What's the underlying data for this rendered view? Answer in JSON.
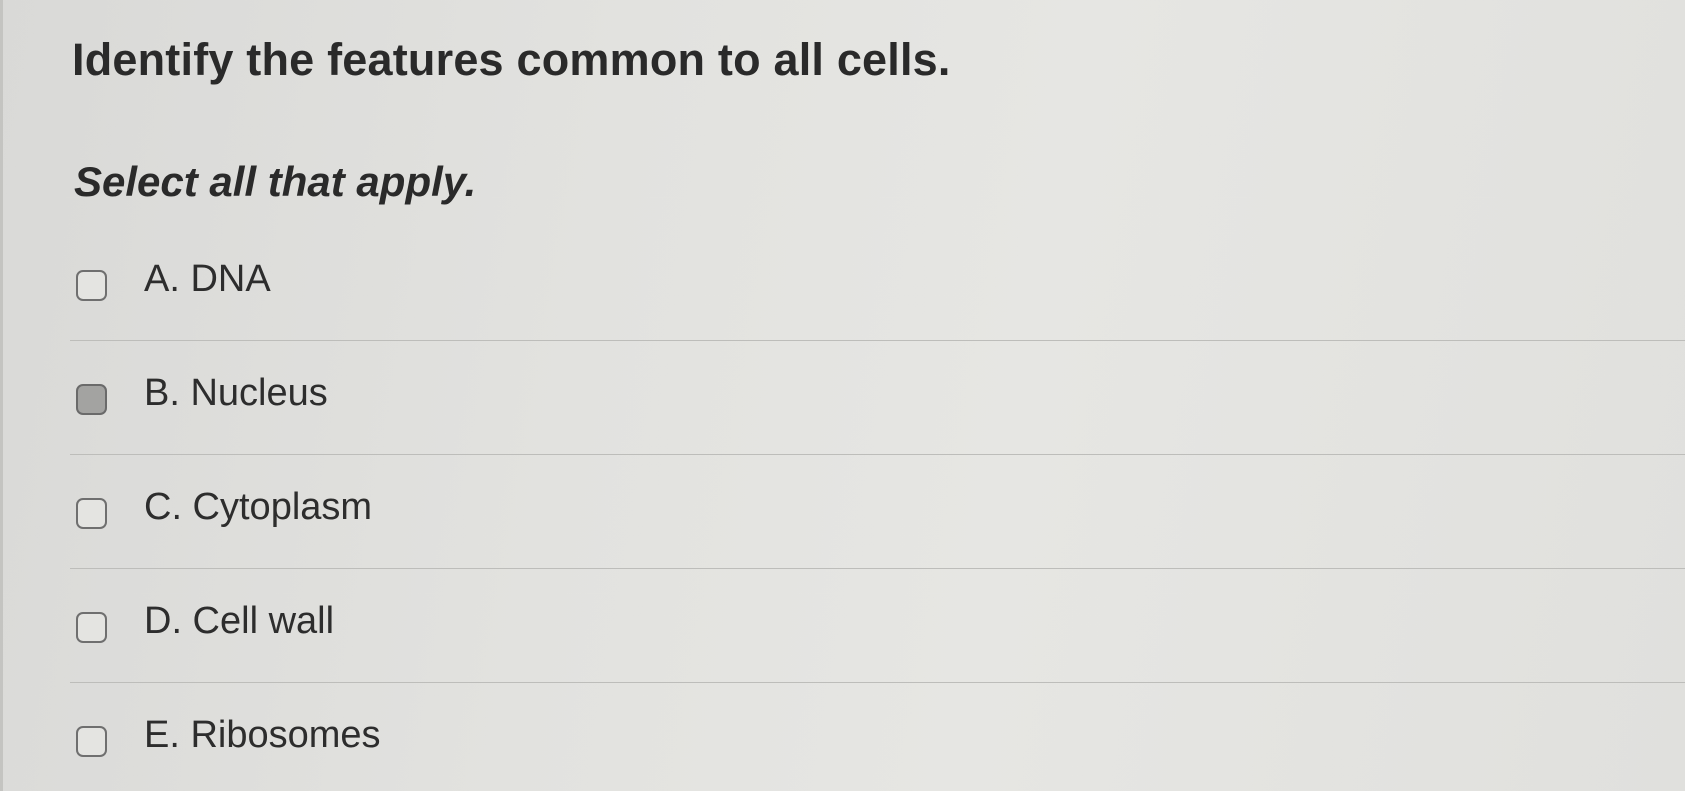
{
  "question": {
    "title": "Identify the features common to all cells.",
    "instruction": "Select all that apply."
  },
  "options": [
    {
      "label": "A. DNA",
      "checked": false,
      "filled": false
    },
    {
      "label": "B. Nucleus",
      "checked": false,
      "filled": true
    },
    {
      "label": "C. Cytoplasm",
      "checked": false,
      "filled": false
    },
    {
      "label": "D. Cell wall",
      "checked": false,
      "filled": false
    },
    {
      "label": "E. Ribosomes",
      "checked": false,
      "filled": false
    }
  ],
  "colors": {
    "background": "#e2e2df",
    "text": "#2b2b2b",
    "checkbox_border": "#6f6f6f",
    "checkbox_filled": "#a3a3a1",
    "divider": "#bdbdba"
  }
}
